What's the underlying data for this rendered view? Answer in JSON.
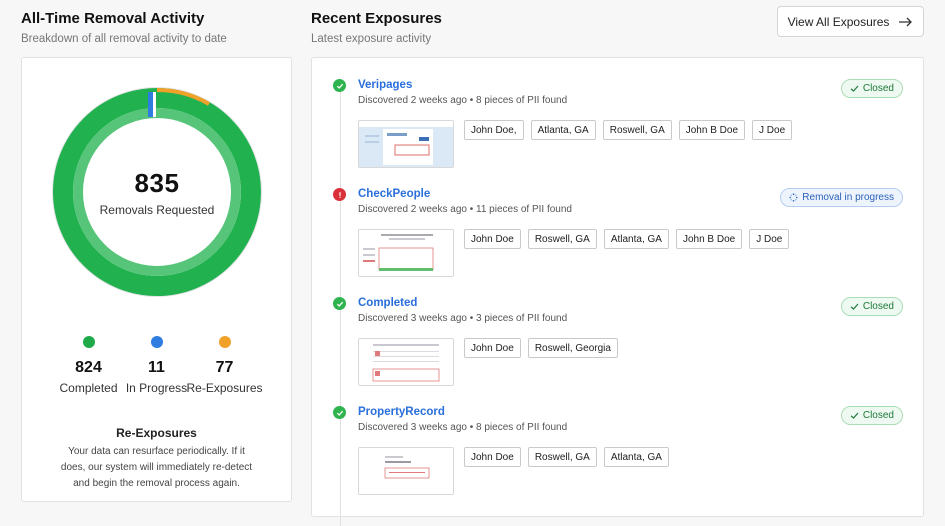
{
  "left": {
    "title": "All-Time Removal Activity",
    "subtitle": "Breakdown of all removal activity to date",
    "total": "835",
    "total_label": "Removals Requested",
    "stats": [
      {
        "value": "824",
        "label": "Completed",
        "color": "#1faa4a"
      },
      {
        "value": "11",
        "label": "In Progress",
        "color": "#2f7de1"
      },
      {
        "value": "77",
        "label": "Re-Exposures",
        "color": "#f0a12a"
      }
    ],
    "re_exposures": {
      "title": "Re-Exposures",
      "body": "Your data can resurface periodically. If it does, our system will immediately re-detect and begin the removal process again."
    }
  },
  "right": {
    "title": "Recent Exposures",
    "subtitle": "Latest exposure activity",
    "view_all_label": "View All Exposures",
    "exposures": [
      {
        "name": "Veripages",
        "meta": "Discovered 2 weeks ago • 8 pieces of PII found",
        "status": "Closed",
        "status_type": "closed",
        "dot_color": "#2eb34f",
        "tags": [
          "John Doe,",
          "Atlanta, GA",
          "Roswell, GA",
          "John B Doe",
          "J Doe"
        ]
      },
      {
        "name": "CheckPeople",
        "meta": "Discovered 2 weeks ago • 11 pieces of PII found",
        "status": "Removal in progress",
        "status_type": "progress",
        "dot_color": "#d9303a",
        "tags": [
          "John Doe",
          "Roswell, GA",
          "Atlanta, GA",
          "John B Doe",
          "J Doe"
        ]
      },
      {
        "name": "Completed",
        "meta": "Discovered 3 weeks ago • 3 pieces of PII found",
        "status": "Closed",
        "status_type": "closed",
        "dot_color": "#2eb34f",
        "tags": [
          "John Doe",
          "Roswell, Georgia"
        ]
      },
      {
        "name": "PropertyRecord",
        "meta": "Discovered 3 weeks ago • 8 pieces of PII found",
        "status": "Closed",
        "status_type": "closed",
        "dot_color": "#2eb34f",
        "tags": [
          "John Doe",
          "Roswell, GA",
          "Atlanta, GA"
        ]
      }
    ]
  }
}
